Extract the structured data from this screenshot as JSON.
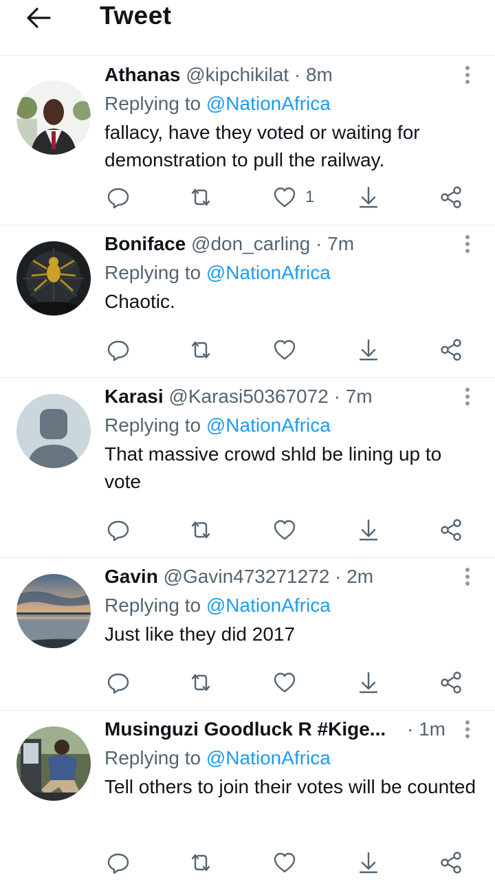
{
  "header": {
    "title": "Tweet",
    "back_icon": "arrow-left-icon"
  },
  "colors": {
    "accent": "#1d9bf0",
    "secondary_text": "#536471",
    "divider": "#e6ecf0"
  },
  "tweets": [
    {
      "name": "Athanas",
      "handle": "@kipchikilat",
      "dot": "·",
      "time": "8m",
      "replying": "Replying to",
      "mention": "@NationAfrica",
      "text": "fallacy, have they voted or waiting for demonstration to pull the railway.",
      "like_count": "1"
    },
    {
      "name": "Boniface",
      "handle": "@don_carling",
      "dot": "·",
      "time": "7m",
      "replying": "Replying to",
      "mention": "@NationAfrica",
      "text": "Chaotic.",
      "like_count": ""
    },
    {
      "name": "Karasi",
      "handle": "@Karasi50367072",
      "dot": "·",
      "time": "7m",
      "replying": "Replying to",
      "mention": "@NationAfrica",
      "text": "That massive crowd shld be lining up to vote",
      "like_count": ""
    },
    {
      "name": "Gavin",
      "handle": "@Gavin473271272",
      "dot": "·",
      "time": "2m",
      "replying": "Replying to",
      "mention": "@NationAfrica",
      "text": "Just like they did 2017",
      "like_count": ""
    },
    {
      "name": "Musinguzi Goodluck R #Kige...",
      "handle": "",
      "dot": "·",
      "time": "1m",
      "replying": "Replying to",
      "mention": "@NationAfrica",
      "text": "Tell others to join their votes will be counted",
      "like_count": ""
    }
  ]
}
